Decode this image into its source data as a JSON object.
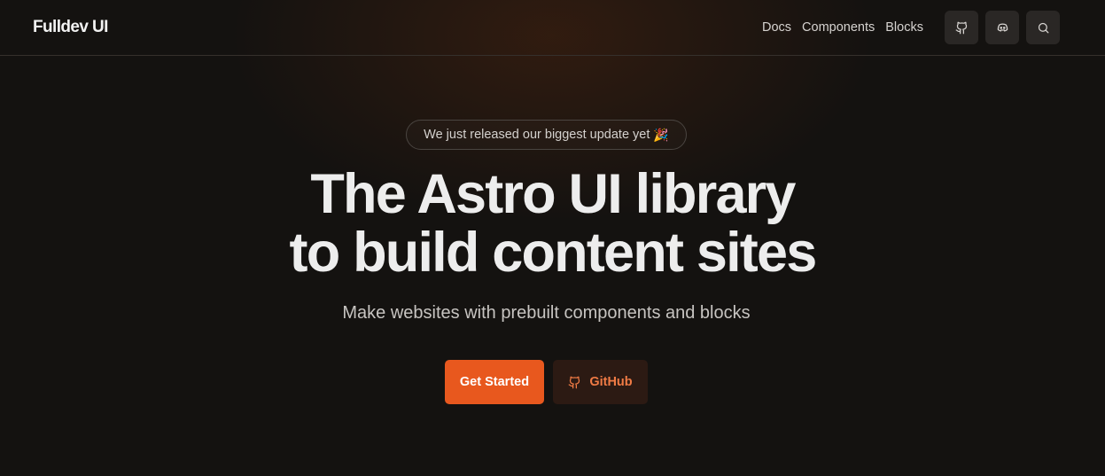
{
  "header": {
    "logo": "Fulldev UI",
    "nav": [
      {
        "label": "Docs"
      },
      {
        "label": "Components"
      },
      {
        "label": "Blocks"
      }
    ],
    "icon_buttons": [
      {
        "icon": "github-icon"
      },
      {
        "icon": "discord-icon"
      },
      {
        "icon": "search-icon"
      }
    ]
  },
  "hero": {
    "announcement": "We just released our biggest update yet",
    "announcement_emoji": "🎉",
    "headline_line1": "The Astro UI library",
    "headline_line2": "to build content sites",
    "subtitle": "Make websites with prebuilt components and blocks",
    "primary_cta": "Get Started",
    "secondary_cta": "GitHub"
  },
  "colors": {
    "background": "#141210",
    "accent": "#e8581e",
    "secondary_button_bg": "#2c1a13",
    "secondary_button_text": "#f07b45"
  }
}
